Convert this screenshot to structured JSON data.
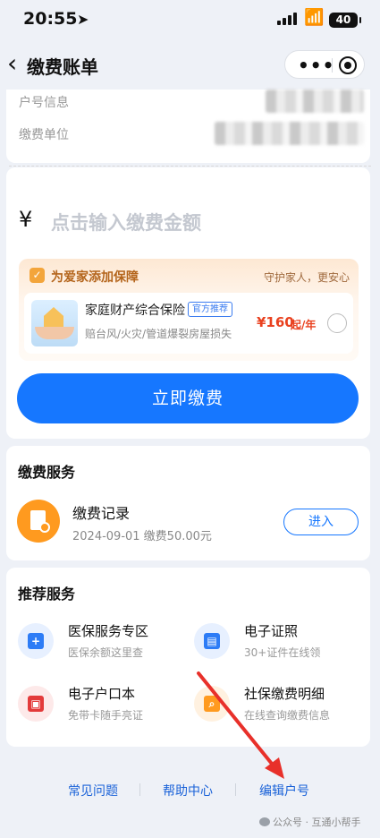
{
  "status_bar": {
    "time": "20:55",
    "battery": "40"
  },
  "nav": {
    "title": "缴费账单",
    "back_icon": "chevron-left-icon",
    "more_icon": "more-dots-icon",
    "target_icon": "target-icon"
  },
  "account": {
    "label_household": "户号信息",
    "label_unit": "缴费单位"
  },
  "payment": {
    "currency": "¥",
    "amount_placeholder": "点击输入缴费金额",
    "pay_button": "立即缴费"
  },
  "protection": {
    "title": "为爱家添加保障",
    "slogan": "守护家人，更安心",
    "insurance_name": "家庭财产综合保险",
    "badge": "官方推荐",
    "coverage": "赔台风/火灾/管道爆裂房屋损失",
    "price": "¥160",
    "price_unit": "起/年",
    "selected": false
  },
  "service": {
    "title": "缴费服务",
    "record_title": "缴费记录",
    "record_sub": "2024-09-01 缴费50.00元",
    "enter_button": "进入"
  },
  "recommend": {
    "title": "推荐服务",
    "items": [
      {
        "name": "医保服务专区",
        "sub": "医保余额这里查",
        "icon": "medical-kit-icon",
        "color": "#2d7cf6"
      },
      {
        "name": "电子证照",
        "sub": "30+证件在线领",
        "icon": "id-card-icon",
        "color": "#2d7cf6"
      },
      {
        "name": "电子户口本",
        "sub": "免带卡随手亮证",
        "icon": "household-book-icon",
        "color": "#e33a3a"
      },
      {
        "name": "社保缴费明细",
        "sub": "在线查询缴费信息",
        "icon": "social-security-search-icon",
        "color": "#ff9a1f"
      }
    ]
  },
  "footer": {
    "links": [
      "常见问题",
      "帮助中心",
      "编辑户号"
    ]
  },
  "watermark": "公众号 · 互通小帮手",
  "colors": {
    "primary": "#1677ff",
    "price": "#e9411f",
    "background": "#eef1f7"
  }
}
